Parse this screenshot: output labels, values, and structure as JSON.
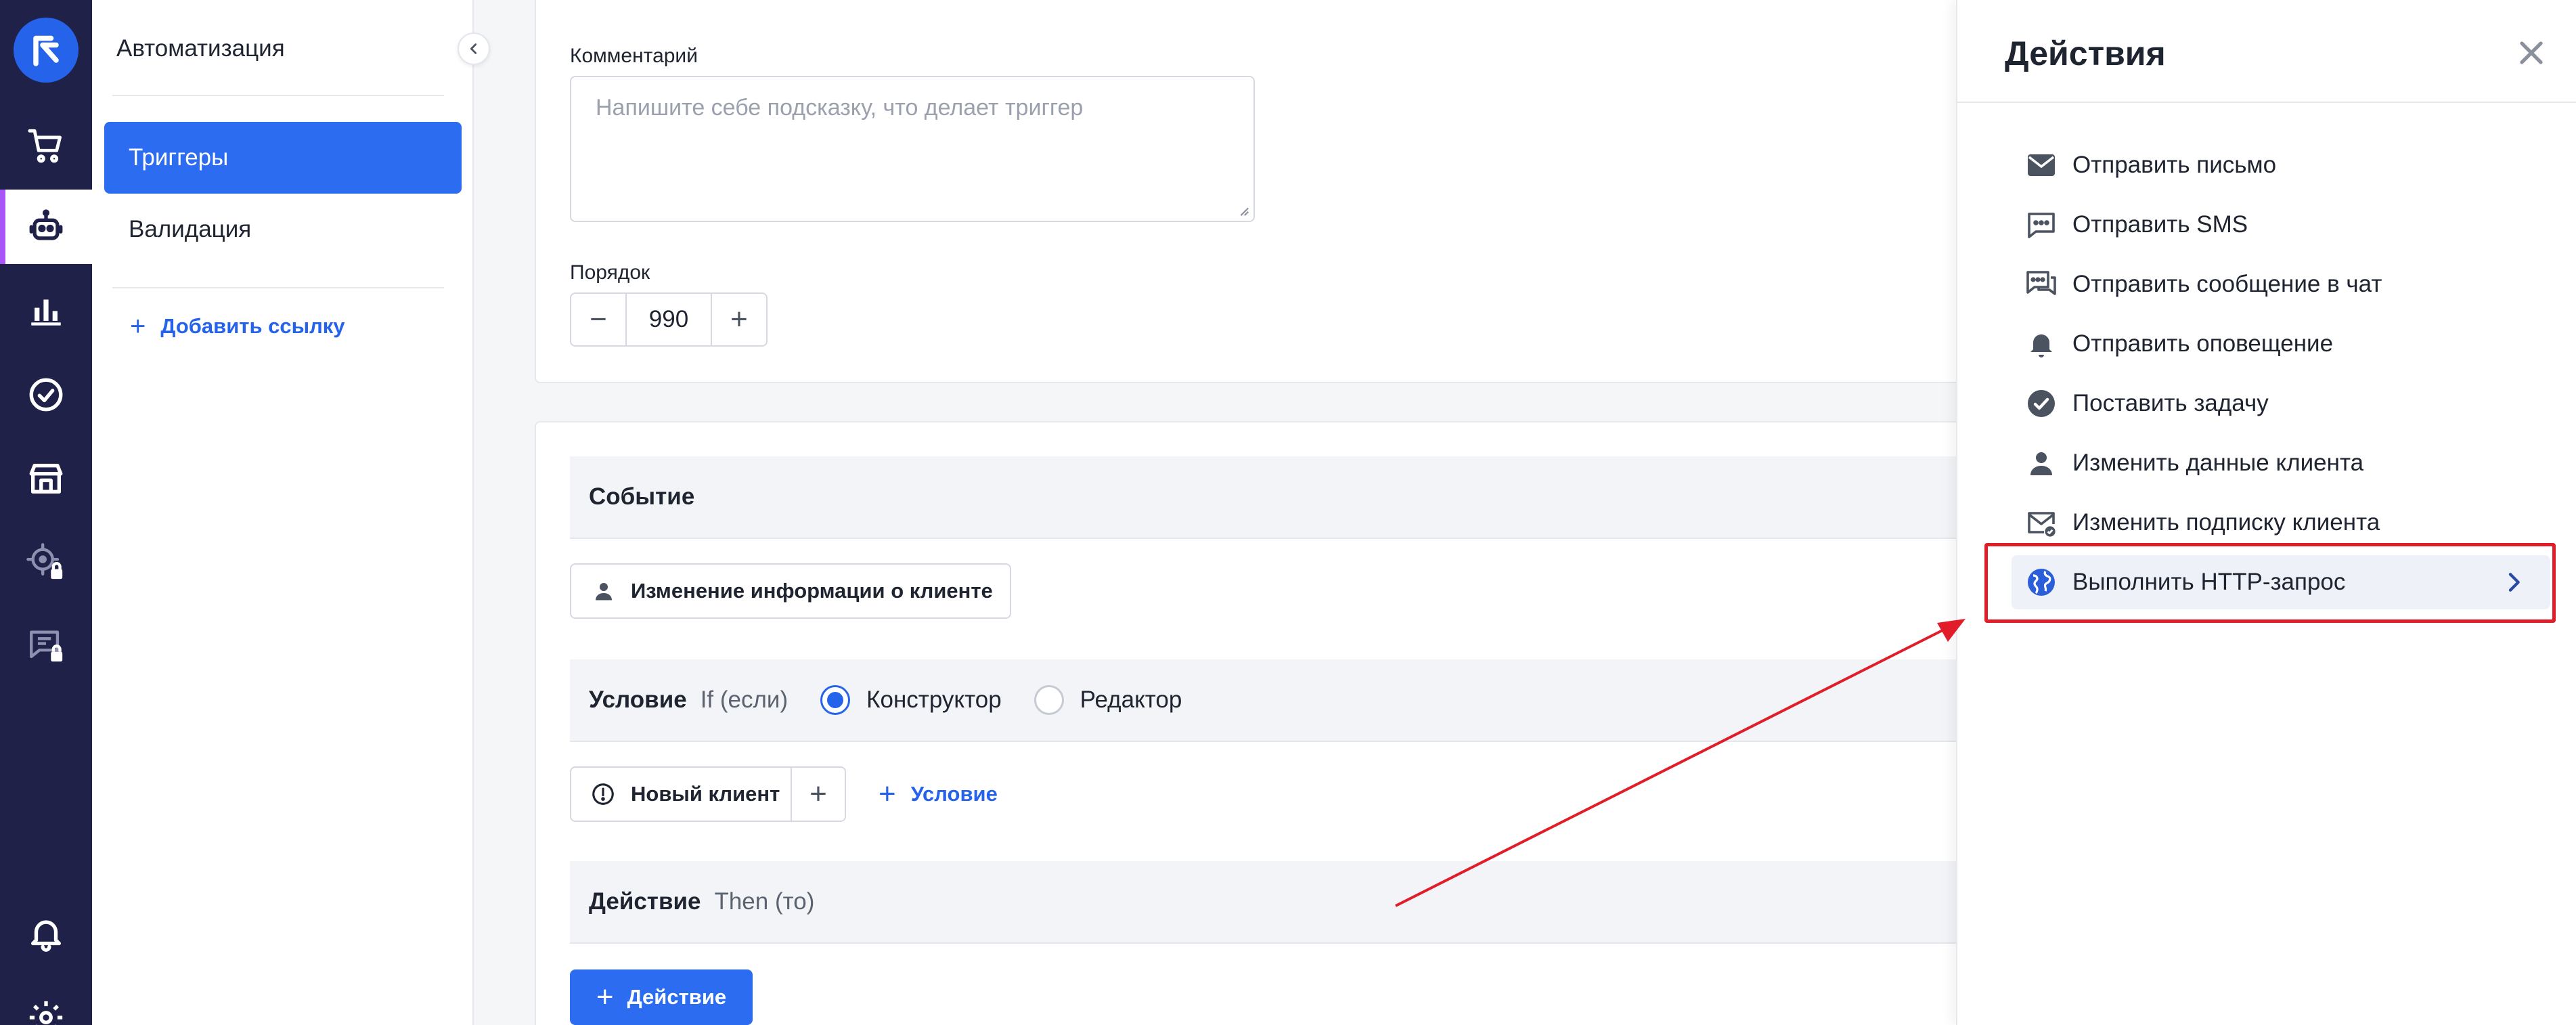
{
  "sidebar": {
    "section_title": "Автоматизация",
    "items": [
      {
        "label": "Триггеры",
        "active": true
      },
      {
        "label": "Валидация",
        "active": false
      }
    ],
    "add_link": "Добавить ссылку"
  },
  "rail": {
    "icons": [
      "logo-icon",
      "cart-icon",
      "robot-icon",
      "analytics-icon",
      "check-circle-icon",
      "store-icon",
      "target-lock-icon",
      "chat-lock-icon",
      "bell-icon",
      "gear-icon"
    ],
    "active_icon": "robot-icon"
  },
  "form": {
    "comment_label": "Комментарий",
    "comment_placeholder": "Напишите себе подсказку, что делает триггер",
    "order_label": "Порядок",
    "order_value": "990",
    "minus": "−",
    "plus": "+"
  },
  "event": {
    "title": "Событие",
    "chip_label": "Изменение информации о клиенте"
  },
  "condition": {
    "title": "Условие",
    "subtitle": "If (если)",
    "mode_constructor": "Конструктор",
    "mode_editor": "Редактор",
    "selected_mode": "Конструктор",
    "chip_label": "Новый клиент",
    "add_condition": "Условие"
  },
  "action": {
    "title": "Действие",
    "subtitle": "Then (то)",
    "add_button": "Действие"
  },
  "drawer": {
    "title": "Действия",
    "items": [
      {
        "label": "Отправить письмо",
        "icon": "mail-icon"
      },
      {
        "label": "Отправить SMS",
        "icon": "sms-icon"
      },
      {
        "label": "Отправить сообщение в чат",
        "icon": "chat-icon"
      },
      {
        "label": "Отправить оповещение",
        "icon": "bell-icon"
      },
      {
        "label": "Поставить задачу",
        "icon": "check-circle-icon"
      },
      {
        "label": "Изменить данные клиента",
        "icon": "user-icon"
      },
      {
        "label": "Изменить подписку клиента",
        "icon": "mail-check-icon"
      },
      {
        "label": "Выполнить HTTP-запрос",
        "icon": "globe-icon",
        "highlighted": true
      }
    ]
  },
  "colors": {
    "rail_bg": "#1f2148",
    "accent": "#2b6cf0",
    "active_marker": "#a855f7",
    "annotation_red": "#e11d2a"
  }
}
